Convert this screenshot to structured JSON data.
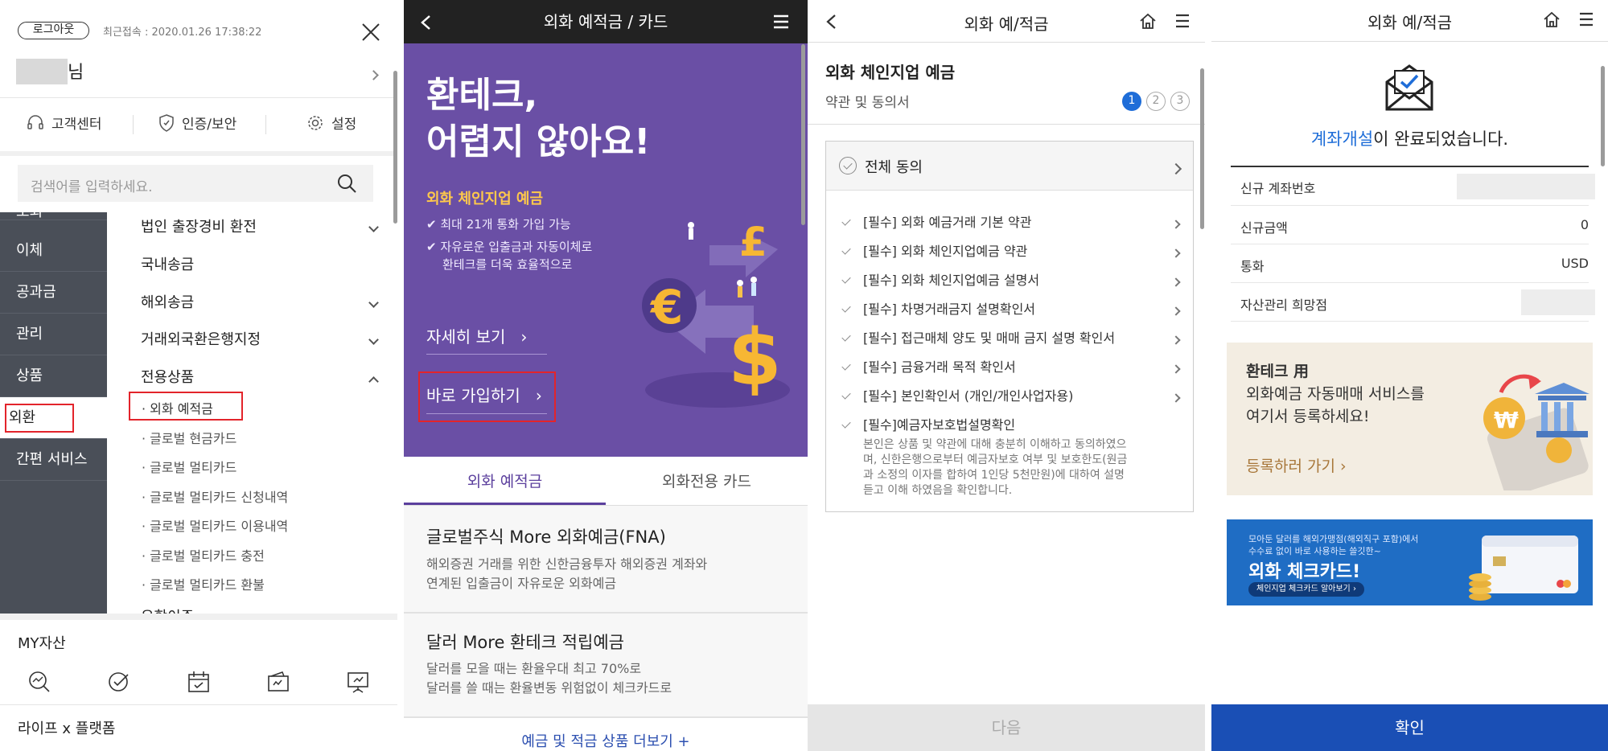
{
  "panel1": {
    "logout_label": "로그아웃",
    "last_login": "최근접속 : 2020.01.26 17:38:22",
    "user_suffix": "님",
    "quick_menu": [
      "고객센터",
      "인증/보안",
      "설정"
    ],
    "search_placeholder": "검색어를 입력하세요.",
    "left_nav": [
      "조회",
      "이체",
      "공과금",
      "관리",
      "상품",
      "외환",
      "간편 서비스"
    ],
    "active_nav": "외환",
    "sub_menu": [
      "법인 출장경비 환전",
      "국내송금",
      "해외송금",
      "거래외국환은행지정",
      "전용상품"
    ],
    "leaf_items": [
      "외화 예적금",
      "글로벌 현금카드",
      "글로벌 멀티카드",
      "글로벌 멀티카드 신청내역",
      "글로벌 멀티카드 이용내역",
      "글로벌 멀티카드 충전",
      "글로벌 멀티카드 환불"
    ],
    "cut_item": "유학이주",
    "my_assets": "MY자산",
    "life_platform": "라이프 x 플랫폼"
  },
  "panel2": {
    "title": "외화 예적금 / 카드",
    "hero_title_1": "환테크,",
    "hero_title_2": "어렵지 않아요!",
    "product_name": "외화 체인지업 예금",
    "features": [
      "최대 21개 통화 가입 가능",
      "자유로운 입출금과 자동이체로",
      "환테크를 더욱 효율적으로"
    ],
    "detail_link": "자세히 보기",
    "join_link": "바로 가입하기",
    "tabs": [
      "외화 예적금",
      "외화전용 카드"
    ],
    "products": [
      {
        "title": "글로벌주식 More 외화예금(FNA)",
        "desc_1": "해외증권 거래를 위한 신한금융투자 해외증권 계좌와",
        "desc_2": "연계된 입출금이 자유로운 외화예금"
      },
      {
        "title": "달러 More 환테크 적립예금",
        "desc_1": "달러를 모을 때는 환율우대 최고 70%로",
        "desc_2": "달러를 쓸 때는 환율변동 위험없이 체크카드로"
      }
    ],
    "more_link": "예금 및 적금 상품 더보기 +"
  },
  "panel3": {
    "title": "외화 예/적금",
    "product": "외화 체인지업 예금",
    "subtitle": "약관 및 동의서",
    "steps": [
      "1",
      "2",
      "3"
    ],
    "agree_all": "전체 동의",
    "terms": [
      "[필수] 외화 예금거래 기본 약관",
      "[필수] 외화 체인지업예금 약관",
      "[필수] 외화 체인지업예금 설명서",
      "[필수] 차명거래금지 설명확인서",
      "[필수] 접근매체 양도 및 매매 금지 설명 확인서",
      "[필수] 금융거래 목적 확인서",
      "[필수] 본인확인서 (개인/개인사업자용)",
      "[필수]예금자보호법설명확인"
    ],
    "notice_1": "본인은 상품 및 약관에 대해 충분히 이해하고 동의하였으",
    "notice_2": "며, 신한은행으로부터 예금자보호 여부 및 보호한도(원금",
    "notice_3": "과 소정의 이자를 합하여 1인당 5천만원)에 대하여 설명",
    "notice_4": "듣고 이해 하였음을 확인합니다.",
    "next_button": "다음"
  },
  "panel4": {
    "title": "외화 예/적금",
    "complete_highlight": "계좌개설",
    "complete_rest": "이 완료되었습니다.",
    "rows": [
      {
        "label": "신규 계좌번호",
        "value": ""
      },
      {
        "label": "신규금액",
        "value": "0"
      },
      {
        "label": "통화",
        "value": "USD"
      },
      {
        "label": "자산관리 희망점",
        "value": ""
      }
    ],
    "banner1_line1": "환테크 用",
    "banner1_line2": "외화예금 자동매매 서비스를",
    "banner1_line3": "여기서 등록하세요!",
    "banner1_link": "등록하러 가기",
    "banner2_small_1": "모아둔 달러를 해외가맹점(해외직구 포함)에서",
    "banner2_small_2": "수수료 없이 바로 사용하는 쓸깃한~",
    "banner2_big": "외화 체크카드!",
    "banner2_button": "체인지업 체크카드 알아보기",
    "ok_button": "확인"
  },
  "colors": {
    "purple": "#6a4fa5",
    "gold": "#ffc94a",
    "blue": "#1a4fb5",
    "red": "#e3242b",
    "dark_nav": "#4a4f58"
  }
}
